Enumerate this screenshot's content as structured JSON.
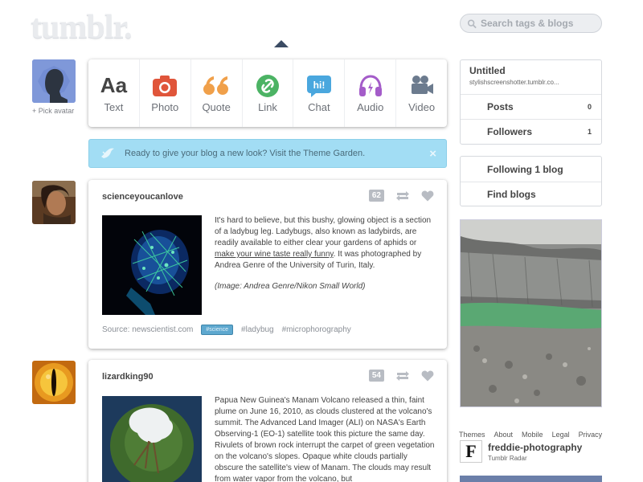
{
  "header": {
    "logo": "tumblr.",
    "search_placeholder": "Search tags & blogs"
  },
  "me": {
    "pick_avatar": "+ Pick avatar"
  },
  "post_types": [
    {
      "label": "Text",
      "icon": "text-icon",
      "color": "#444444"
    },
    {
      "label": "Photo",
      "icon": "camera-icon",
      "color": "#e0553a"
    },
    {
      "label": "Quote",
      "icon": "quote-icon",
      "color": "#f0a04a"
    },
    {
      "label": "Link",
      "icon": "link-icon",
      "color": "#4cb364"
    },
    {
      "label": "Chat",
      "icon": "chat-icon",
      "color": "#4aa7de"
    },
    {
      "label": "Audio",
      "icon": "headphones-icon",
      "color": "#a45cc9"
    },
    {
      "label": "Video",
      "icon": "video-camera-icon",
      "color": "#6c7b8e"
    }
  ],
  "theme_banner": {
    "text": "Ready to give your blog a new look? Visit the Theme Garden.",
    "close": "×"
  },
  "posts": [
    {
      "blog": "scienceyoucanlove",
      "notes": "62",
      "text_before_link": "It's hard to believe, but this bushy, glowing object is a section of a ladybug leg. Ladybugs, also known as ladybirds, are readily available to either clear your gardens of aphids or ",
      "link": "make your wine taste really funny",
      "text_after_link": ". It was photographed by Andrea Genre of the University of Turin, Italy.",
      "caption": "(Image: Andrea Genre/Nikon Small World)",
      "source_label": "Source: newscientist.com",
      "tag_pill": "#science",
      "tags": [
        "#ladybug",
        "#microphorography"
      ]
    },
    {
      "blog": "lizardking90",
      "notes": "54",
      "text": "Papua New Guinea's Manam Volcano released a thin, faint plume on June 16, 2010, as clouds clustered at the volcano's summit. The Advanced Land Imager (ALI) on NASA's Earth Observing-1 (EO-1) satellite took this picture the same day. Rivulets of brown rock interrupt the carpet of green vegetation on the volcano's slopes. Opaque white clouds partially obscure the satellite's view of Manam. The clouds may result from water vapor from the volcano, but"
    }
  ],
  "sidebar": {
    "blog_title": "Untitled",
    "blog_url": "stylishscreenshotter.tumblr.co...",
    "posts_label": "Posts",
    "posts_count": "0",
    "followers_label": "Followers",
    "followers_count": "1",
    "following_label": "Following 1 blog",
    "find_blogs_label": "Find blogs",
    "footer_links": [
      "Themes",
      "About",
      "Mobile",
      "Legal",
      "Privacy"
    ],
    "radar_name": "freddie-photography",
    "radar_sub": "Tumblr Radar",
    "radar_icon_letter": "F"
  }
}
